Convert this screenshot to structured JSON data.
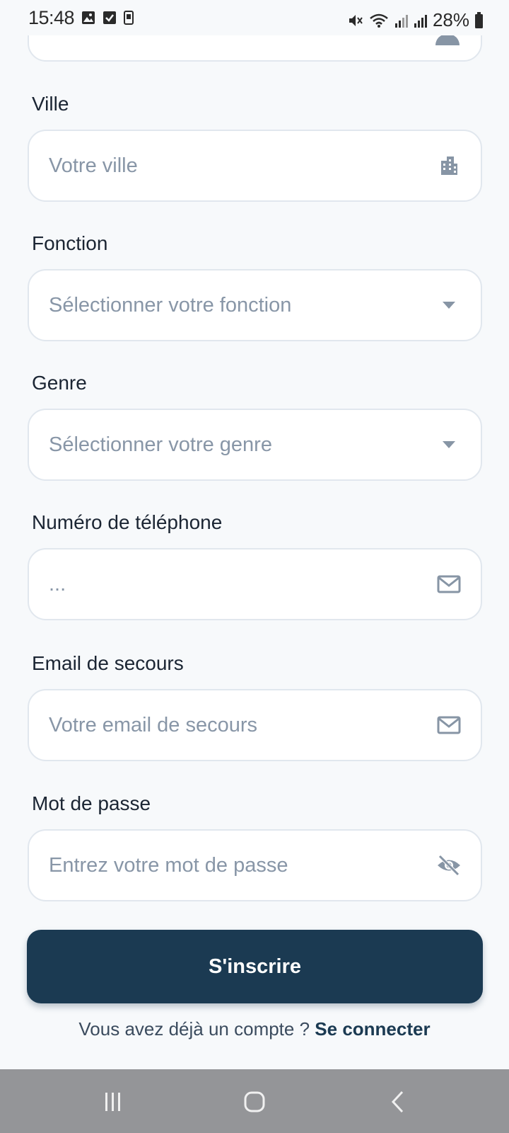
{
  "status_bar": {
    "time": "15:48",
    "battery": "28%",
    "left_icons": [
      "image-icon",
      "checkbox-icon",
      "phone-icon"
    ],
    "right_icons": [
      "mute-icon",
      "wifi-icon",
      "signal-icon",
      "signal-icon",
      "battery-icon"
    ]
  },
  "form": {
    "city": {
      "label": "Ville",
      "placeholder": "Votre ville",
      "icon": "building-icon"
    },
    "function": {
      "label": "Fonction",
      "placeholder": "Sélectionner votre fonction",
      "icon": "dropdown-arrow-icon"
    },
    "gender": {
      "label": "Genre",
      "placeholder": "Sélectionner votre genre",
      "icon": "dropdown-arrow-icon"
    },
    "phone": {
      "label": "Numéro de téléphone",
      "placeholder": "...",
      "icon": "mail-icon"
    },
    "backup_email": {
      "label": "Email de secours",
      "placeholder": "Votre email de secours",
      "icon": "mail-icon"
    },
    "password": {
      "label": "Mot de passe",
      "placeholder": "Entrez votre mot de passe",
      "icon": "eye-off-icon"
    }
  },
  "submit_label": "S'inscrire",
  "login_prompt": {
    "text": "Vous avez déjà un compte ?",
    "link": "Se connecter"
  },
  "colors": {
    "primary": "#1b3a52",
    "background": "#f7f9fb",
    "placeholder": "#8896a7",
    "border": "#e1e7ee",
    "nav_bar": "#949598"
  },
  "nav_bar": {
    "buttons": [
      "recent-apps-icon",
      "home-icon",
      "back-icon"
    ]
  }
}
